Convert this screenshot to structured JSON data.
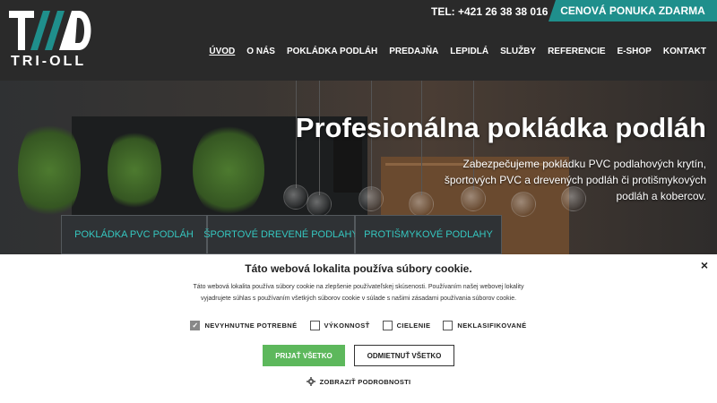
{
  "header": {
    "logo_text": "TRI-OLL",
    "phone": "TEL: +421 26 38 38 016",
    "cta": "CENOVÁ PONUKA ZDARMA",
    "nav": [
      "ÚVOD",
      "O NÁS",
      "POKLÁDKA PODLÁH",
      "PREDAJŇA",
      "LEPIDLÁ",
      "SLUŽBY",
      "REFERENCIE",
      "E-SHOP",
      "KONTAKT"
    ]
  },
  "hero": {
    "title": "Profesionálna pokládka podláh",
    "subtitle": "Zabezpečujeme pokládku PVC podlahových krytín, športových PVC a drevených podláh či protišmykových podláh a kobercov."
  },
  "categories": [
    "POKLÁDKA PVC PODLÁH",
    "ŠPORTOVÉ DREVENÉ PODLAHY",
    "PROTIŠMYKOVÉ PODLAHY"
  ],
  "cookie": {
    "title": "Táto webová lokalita používa súbory cookie.",
    "text": "Táto webová lokalita používa súbory cookie na zlepšenie používateľskej skúsenosti. Používaním našej webovej lokality vyjadrujete súhlas s používaním všetkých súborov cookie v súlade s našimi zásadami používania súborov cookie.",
    "options": [
      {
        "label": "NEVYHNUTNE POTREBNÉ",
        "checked": true
      },
      {
        "label": "VÝKONNOSŤ",
        "checked": false
      },
      {
        "label": "CIELENIE",
        "checked": false
      },
      {
        "label": "NEKLASIFIKOVANÉ",
        "checked": false
      }
    ],
    "accept": "PRIJAŤ VŠETKO",
    "reject": "ODMIETNUŤ VŠETKO",
    "details": "ZOBRAZIŤ PODROBNOSTI",
    "close": "×"
  },
  "colors": {
    "accent": "#1f8f8c",
    "category_text": "#35c7c0",
    "accept": "#5db85c"
  }
}
